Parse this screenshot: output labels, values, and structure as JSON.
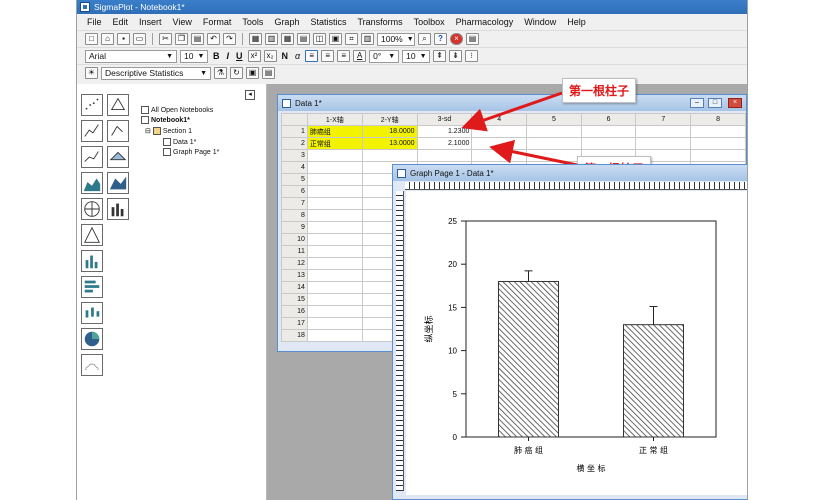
{
  "app": {
    "title": "SigmaPlot - Notebook1*"
  },
  "menu": [
    "File",
    "Edit",
    "Insert",
    "View",
    "Format",
    "Tools",
    "Graph",
    "Statistics",
    "Transforms",
    "Toolbox",
    "Pharmacology",
    "Window",
    "Help"
  ],
  "toolbar": {
    "zoom": "100%",
    "font_name": "Arial",
    "font_size": "10",
    "bold": "B",
    "italic": "I",
    "underline": "U",
    "normal": "N",
    "alpha": "α",
    "rotation": "0°",
    "size2": "10",
    "stats_combo": "Descriptive Statistics"
  },
  "tree": {
    "root": "All Open Notebooks",
    "notebook": "Notebook1*",
    "section": "Section 1",
    "data": "Data 1*",
    "graph": "Graph Page 1*"
  },
  "worksheet": {
    "title": "Data 1*",
    "columns": [
      "1-X轴",
      "2-Y轴",
      "3-sd",
      "4",
      "5",
      "6",
      "7",
      "8"
    ],
    "rows": [
      {
        "n": "1",
        "x": "肺癌组",
        "y": "18.0000",
        "sd": "1.2300"
      },
      {
        "n": "2",
        "x": "正常组",
        "y": "13.0000",
        "sd": "2.1000"
      },
      {
        "n": "3"
      },
      {
        "n": "4"
      },
      {
        "n": "5"
      },
      {
        "n": "6"
      },
      {
        "n": "7"
      },
      {
        "n": "8"
      },
      {
        "n": "9"
      },
      {
        "n": "10"
      },
      {
        "n": "11"
      },
      {
        "n": "12"
      },
      {
        "n": "13"
      },
      {
        "n": "14"
      },
      {
        "n": "15"
      },
      {
        "n": "16"
      },
      {
        "n": "17"
      },
      {
        "n": "18"
      }
    ]
  },
  "annotations": {
    "first_bar": "第一根柱子",
    "second_bar": "第二根柱子"
  },
  "graph_window": {
    "title": "Graph Page 1 - Data 1*"
  },
  "chart_data": {
    "type": "bar",
    "categories": [
      "肺 癌 组",
      "正 常 组"
    ],
    "values": [
      18.0,
      13.0
    ],
    "errors": [
      1.23,
      2.1
    ],
    "xlabel": "横 坐 标",
    "ylabel": "纵坐标",
    "ylim": [
      0,
      25
    ],
    "yticks": [
      0,
      5,
      10,
      15,
      20,
      25
    ],
    "bar_fill": "diagonal-hatch",
    "grid": false
  },
  "colors": {
    "highlight": "#f3f200",
    "callout_text": "#e0191b",
    "arrow": "#e0191b",
    "workspace": "#a9a9a9"
  }
}
